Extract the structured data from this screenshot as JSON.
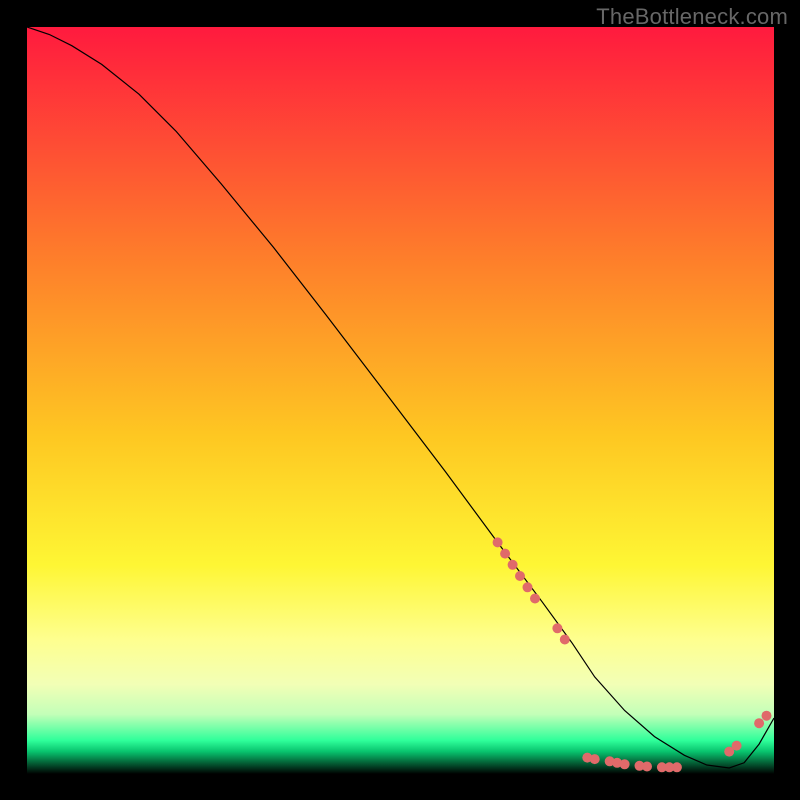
{
  "watermark": "TheBottleneck.com",
  "chart_data": {
    "type": "line",
    "title": "",
    "xlabel": "",
    "ylabel": "",
    "xlim": [
      0,
      100
    ],
    "ylim": [
      0,
      100
    ],
    "grid": false,
    "legend": false,
    "background": {
      "description": "vertical heat gradient, red (top) → orange → yellow → pale-yellow → thin green band just above bottom",
      "stops": [
        {
          "y": 0,
          "color": "#ff1a3e"
        },
        {
          "y": 30,
          "color": "#fe7b2b"
        },
        {
          "y": 55,
          "color": "#fec822"
        },
        {
          "y": 72,
          "color": "#fef634"
        },
        {
          "y": 82,
          "color": "#feff8f"
        },
        {
          "y": 88,
          "color": "#f2ffb6"
        },
        {
          "y": 92,
          "color": "#c3ffb8"
        },
        {
          "y": 95.5,
          "color": "#2fff9a"
        },
        {
          "y": 97,
          "color": "#08c36e"
        },
        {
          "y": 100,
          "color": "#000000"
        }
      ]
    },
    "series": [
      {
        "name": "bottleneck-curve",
        "stroke": "#000000",
        "stroke_width": 1.2,
        "x": [
          0,
          3,
          6,
          10,
          15,
          20,
          26,
          33,
          40,
          48,
          56,
          63,
          69,
          73,
          76,
          80,
          84,
          88,
          91,
          94,
          96,
          98,
          100
        ],
        "y": [
          100,
          99,
          97.5,
          95,
          91,
          86,
          79,
          70.5,
          61.5,
          51,
          40.5,
          31,
          23,
          17.5,
          13,
          8.5,
          5,
          2.5,
          1.2,
          0.8,
          1.5,
          4,
          7.5
        ]
      },
      {
        "name": "markers",
        "type": "scatter",
        "marker_color": "#e06a6a",
        "marker_radius": 5,
        "points": [
          {
            "x": 63,
            "y": 31
          },
          {
            "x": 64,
            "y": 29.5
          },
          {
            "x": 65,
            "y": 28
          },
          {
            "x": 66,
            "y": 26.5
          },
          {
            "x": 67,
            "y": 25
          },
          {
            "x": 68,
            "y": 23.5
          },
          {
            "x": 71,
            "y": 19.5
          },
          {
            "x": 72,
            "y": 18
          },
          {
            "x": 75,
            "y": 2.2
          },
          {
            "x": 76,
            "y": 2.0
          },
          {
            "x": 78,
            "y": 1.7
          },
          {
            "x": 79,
            "y": 1.5
          },
          {
            "x": 80,
            "y": 1.3
          },
          {
            "x": 82,
            "y": 1.1
          },
          {
            "x": 83,
            "y": 1.0
          },
          {
            "x": 85,
            "y": 0.9
          },
          {
            "x": 86,
            "y": 0.9
          },
          {
            "x": 87,
            "y": 0.9
          },
          {
            "x": 94,
            "y": 3.0
          },
          {
            "x": 95,
            "y": 3.8
          },
          {
            "x": 98,
            "y": 6.8
          },
          {
            "x": 99,
            "y": 7.8
          }
        ]
      }
    ]
  }
}
